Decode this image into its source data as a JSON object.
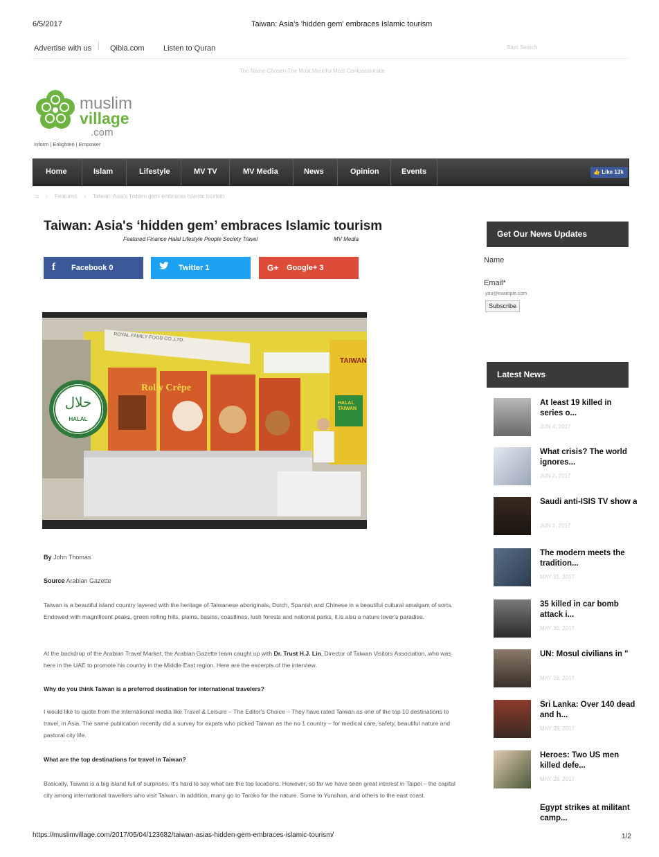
{
  "print_header": {
    "date": "6/5/2017",
    "page_title": "Taiwan: Asia's 'hidden gem' embraces Islamic tourism"
  },
  "topnav": {
    "items": [
      "Advertise with us",
      "Qibla.com",
      "Listen to Quran"
    ],
    "search_label": "Start Search"
  },
  "tagline_banner": "The Name Chosen The Most Merciful Most Compassionate",
  "logo": {
    "line1": "muslim",
    "line2": "village",
    "line3": ".com",
    "tagline": "Inform | Enlighten | Empower"
  },
  "nav": {
    "items": [
      "Home",
      "Islam",
      "Lifestyle",
      "MV TV",
      "MV Media",
      "News",
      "Opinion",
      "Events"
    ],
    "like_label": "Like 13k"
  },
  "breadcrumb": {
    "items": [
      "Featured",
      "Taiwan: Asia's 'hidden gem' embraces Islamic tourism"
    ]
  },
  "article": {
    "title": "Taiwan: Asia's ‘hidden gem’ embraces Islamic tourism",
    "categories": "Featured Finance Halal Lifestyle People Society Travel",
    "source_tag": "MV Media",
    "share": {
      "facebook": "Facebook 0",
      "twitter": "Twitter 1",
      "google": "Google+ 3"
    },
    "image": {
      "booth_sign": "ROYAL FAMILY FOOD CO.,LTD.",
      "taiwan_sign": "TAIWAN",
      "halal_sign": "HALAL TAIWAN",
      "halal_logo_arabic": "حلال",
      "halal_logo_latin": "HALAL",
      "brand": "Rolly Crêpe"
    },
    "by_label": "By",
    "by_value": "John Thomas",
    "source_label": "Source",
    "source_value": "Arabian Gazette",
    "p1": "Taiwan is a beautiful island country layered with the heritage of Taiwanese aboriginals, Dutch, Spanish and Chinese in a beautiful cultural amalgam of sorts. Endowed with magnificent peaks, green rolling hills, plains, basins, coastlines, lush forests and national parks, it is also a nature lover's paradise.",
    "p2_pre": "At the backdrop of the Arabian Travel Market, the Arabian Gazette team caught up with ",
    "p2_bold": "Dr. Trust H.J. Lin",
    "p2_post": ", Director of Taiwan Visitors Association, who was here in the UAE to promote his country in the Middle East region. Here are the excerpts of the interview.",
    "q1": "Why do you think Taiwan is a preferred destination for international travelers?",
    "a1": "I would like to quote from the international media like Travel & Leisure – The Editor's Choice – They have rated Taiwan as one of the top 10 destinations to travel, in Asia. The same publication recently did a survey for expats who picked Taiwan as the no 1 country – for medical care, safety, beautiful nature and pastoral city life.",
    "q2": "What are the top destinations for travel in Taiwan?",
    "a2": "Basically, Taiwan is a big island full of surprises. It's hard to say what are the top locations. However, so far we have seen great interest in Taipei – the capital city among international travellers who visit Taiwan. In addition, many go to Taroko for the nature. Some to Yunshan, and others to the east coast."
  },
  "sidebar": {
    "newsletter": {
      "heading": "Get Our News Updates",
      "name_label": "Name",
      "email_label": "Email*",
      "email_placeholder": "you@example.com",
      "subscribe": "Subscribe"
    },
    "latest": {
      "heading": "Latest News",
      "items": [
        {
          "title": "At least 19 killed in series o...",
          "date": "JUN 4, 2017"
        },
        {
          "title": "What crisis? The world ignores...",
          "date": "JUN 2, 2017"
        },
        {
          "title": "Saudi anti-ISIS TV show actors...",
          "date": "JUN 1, 2017"
        },
        {
          "title": "The modern meets the tradition...",
          "date": "MAY 31, 2017"
        },
        {
          "title": "35 killed in car bomb attack i...",
          "date": "MAY 30, 2017"
        },
        {
          "title": "UN: Mosul civilians in \"",
          "date": "MAY 29, 2017"
        },
        {
          "title": "Sri Lanka: Over 140 dead and h...",
          "date": "MAY 28, 2017"
        },
        {
          "title": "Heroes: Two US men killed defe...",
          "date": "MAY 28, 2017"
        },
        {
          "title": "Egypt strikes at militant camp...",
          "date": ""
        }
      ]
    }
  },
  "footer": {
    "url": "https://muslimvillage.com/2017/05/04/123682/taiwan-asias-hidden-gem-embraces-islamic-tourism/",
    "page": "1/2"
  },
  "colors": {
    "logo_green": "#6db33f",
    "logo_gray": "#8a8a8a",
    "nav_dark": "#333333",
    "facebook": "#3b5998",
    "twitter": "#1da1f2",
    "google": "#dd4b39"
  }
}
